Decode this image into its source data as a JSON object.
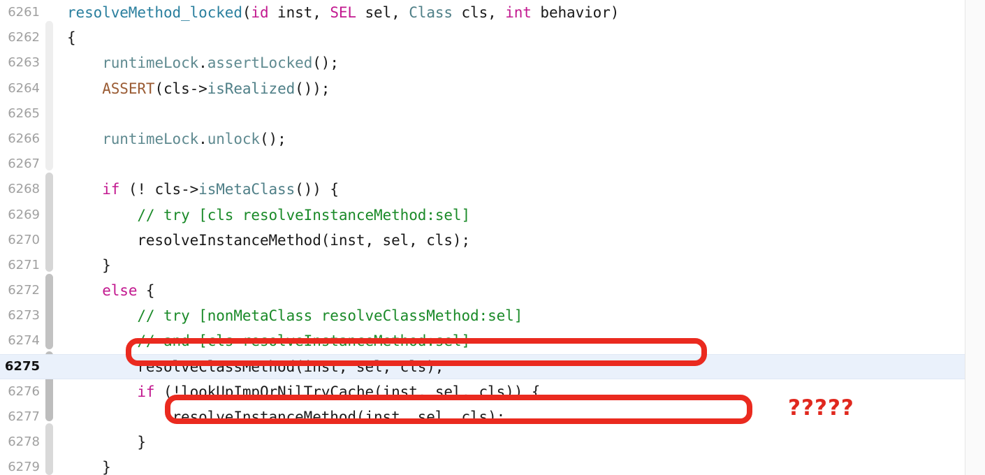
{
  "editor": {
    "active_line": "6275",
    "accent_red": "#ea2a1f",
    "active_row_bg": "#eaf1fb",
    "lineno_color": "#a0a0a0",
    "annotation_note": "?????",
    "first_line_number": 6261,
    "last_line_number": 6279
  },
  "syntax_colors": {
    "keyword": "#c2188f",
    "type": "#4f7f87",
    "function_decl": "#2a7f9e",
    "variable": "#5f8a90",
    "macro": "#9a5b33",
    "comment": "#1a8a28",
    "plain": "#1a1a1a"
  },
  "lines": [
    {
      "no": "6261",
      "active": false,
      "tokens": [
        {
          "t": "resolveMethod_locked",
          "c": "fn"
        },
        {
          "t": "(",
          "c": "pl"
        },
        {
          "t": "id",
          "c": "kw"
        },
        {
          "t": " inst, ",
          "c": "pl"
        },
        {
          "t": "SEL",
          "c": "kw"
        },
        {
          "t": " sel, ",
          "c": "pl"
        },
        {
          "t": "Class",
          "c": "typ"
        },
        {
          "t": " cls, ",
          "c": "pl"
        },
        {
          "t": "int",
          "c": "kw"
        },
        {
          "t": " behavior)",
          "c": "pl"
        }
      ]
    },
    {
      "no": "6262",
      "active": false,
      "tokens": [
        {
          "t": "{",
          "c": "pl"
        }
      ]
    },
    {
      "no": "6263",
      "active": false,
      "tokens": [
        {
          "t": "    ",
          "c": "pl"
        },
        {
          "t": "runtimeLock",
          "c": "var"
        },
        {
          "t": ".",
          "c": "pl"
        },
        {
          "t": "assertLocked",
          "c": "var"
        },
        {
          "t": "();",
          "c": "pl"
        }
      ]
    },
    {
      "no": "6264",
      "active": false,
      "tokens": [
        {
          "t": "    ",
          "c": "pl"
        },
        {
          "t": "ASSERT",
          "c": "mac"
        },
        {
          "t": "(cls->",
          "c": "pl"
        },
        {
          "t": "isRealized",
          "c": "typ"
        },
        {
          "t": "());",
          "c": "pl"
        }
      ]
    },
    {
      "no": "6265",
      "active": false,
      "tokens": []
    },
    {
      "no": "6266",
      "active": false,
      "tokens": [
        {
          "t": "    ",
          "c": "pl"
        },
        {
          "t": "runtimeLock",
          "c": "var"
        },
        {
          "t": ".",
          "c": "pl"
        },
        {
          "t": "unlock",
          "c": "var"
        },
        {
          "t": "();",
          "c": "pl"
        }
      ]
    },
    {
      "no": "6267",
      "active": false,
      "tokens": []
    },
    {
      "no": "6268",
      "active": false,
      "tokens": [
        {
          "t": "    ",
          "c": "pl"
        },
        {
          "t": "if",
          "c": "kw"
        },
        {
          "t": " (! cls->",
          "c": "pl"
        },
        {
          "t": "isMetaClass",
          "c": "typ"
        },
        {
          "t": "()) {",
          "c": "pl"
        }
      ]
    },
    {
      "no": "6269",
      "active": false,
      "tokens": [
        {
          "t": "        ",
          "c": "pl"
        },
        {
          "t": "// try [cls resolveInstanceMethod:sel]",
          "c": "cmt"
        }
      ]
    },
    {
      "no": "6270",
      "active": false,
      "tokens": [
        {
          "t": "        resolveInstanceMethod(inst, sel, cls);",
          "c": "pl"
        }
      ]
    },
    {
      "no": "6271",
      "active": false,
      "tokens": [
        {
          "t": "    }",
          "c": "pl"
        }
      ]
    },
    {
      "no": "6272",
      "active": false,
      "tokens": [
        {
          "t": "    ",
          "c": "pl"
        },
        {
          "t": "else",
          "c": "kw"
        },
        {
          "t": " {",
          "c": "pl"
        }
      ]
    },
    {
      "no": "6273",
      "active": false,
      "tokens": [
        {
          "t": "        ",
          "c": "pl"
        },
        {
          "t": "// try [nonMetaClass resolveClassMethod:sel]",
          "c": "cmt"
        }
      ]
    },
    {
      "no": "6274",
      "active": false,
      "tokens": [
        {
          "t": "        ",
          "c": "pl"
        },
        {
          "t": "// and [cls resolveInstanceMethod:sel]",
          "c": "cmt"
        }
      ]
    },
    {
      "no": "6275",
      "active": true,
      "tokens": [
        {
          "t": "        resolveClassMethod(inst, sel, cls);",
          "c": "pl"
        }
      ]
    },
    {
      "no": "6276",
      "active": false,
      "tokens": [
        {
          "t": "        ",
          "c": "pl"
        },
        {
          "t": "if",
          "c": "kw"
        },
        {
          "t": " (!lookUpImpOrNilTryCache(inst, sel, cls)) {",
          "c": "pl"
        }
      ]
    },
    {
      "no": "6277",
      "active": false,
      "tokens": [
        {
          "t": "            resolveInstanceMethod(inst, sel, cls);",
          "c": "pl"
        }
      ]
    },
    {
      "no": "6278",
      "active": false,
      "tokens": [
        {
          "t": "        }",
          "c": "pl"
        }
      ]
    },
    {
      "no": "6279",
      "active": false,
      "tokens": [
        {
          "t": "    }",
          "c": "pl"
        }
      ]
    }
  ]
}
